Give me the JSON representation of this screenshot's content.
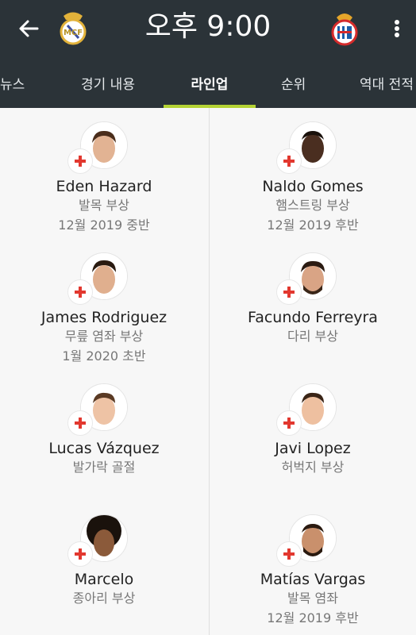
{
  "header": {
    "title": "오후 9:00",
    "home_crest": "real-madrid-crest",
    "away_crest": "espanyol-crest",
    "back_icon": "arrow-left-icon",
    "more_icon": "more-vertical-icon"
  },
  "tabs": [
    {
      "label": "뉴스",
      "active": false
    },
    {
      "label": "경기 내용",
      "active": false
    },
    {
      "label": "라인업",
      "active": true
    },
    {
      "label": "순위",
      "active": false
    },
    {
      "label": "역대 전적",
      "active": false
    }
  ],
  "colors": {
    "header_bg": "#2b3338",
    "tab_indicator": "#b5d334",
    "injury_cross": "#e2382f"
  },
  "players": {
    "home": [
      {
        "name": "Eden Hazard",
        "injury": "발목 부상",
        "return": "12월 2019 중반"
      },
      {
        "name": "James Rodriguez",
        "injury": "무릎 염좌 부상",
        "return": "1월 2020 초반"
      },
      {
        "name": "Lucas Vázquez",
        "injury": "발가락 골절",
        "return": ""
      },
      {
        "name": "Marcelo",
        "injury": "종아리 부상",
        "return": ""
      }
    ],
    "away": [
      {
        "name": "Naldo Gomes",
        "injury": "햄스트링 부상",
        "return": "12월 2019 후반"
      },
      {
        "name": "Facundo Ferreyra",
        "injury": "다리 부상",
        "return": ""
      },
      {
        "name": "Javi Lopez",
        "injury": "허벅지 부상",
        "return": ""
      },
      {
        "name": "Matías Vargas",
        "injury": "발목 염좌",
        "return": "12월 2019 후반"
      }
    ]
  }
}
